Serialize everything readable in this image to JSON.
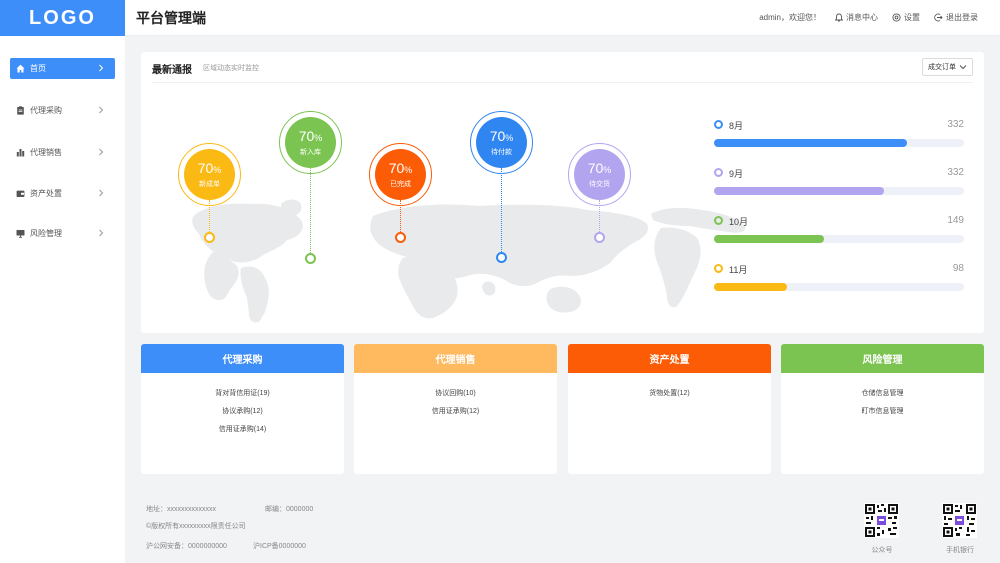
{
  "header": {
    "logo": "LOGO",
    "app_title": "平台管理端",
    "greeting": "admin，欢迎您！",
    "messages_label": "消息中心",
    "settings_label": "设置",
    "logout_label": "退出登录"
  },
  "sidebar": {
    "items": [
      {
        "label": "首页",
        "icon": "home-icon",
        "active": true
      },
      {
        "label": "代理采购",
        "icon": "clipboard-icon",
        "active": false
      },
      {
        "label": "代理销售",
        "icon": "bar-chart-icon",
        "active": false
      },
      {
        "label": "资产处置",
        "icon": "wallet-icon",
        "active": false
      },
      {
        "label": "风险管理",
        "icon": "monitor-icon",
        "active": false
      }
    ]
  },
  "panel": {
    "title": "最新通报",
    "subtitle": "区域动态实时监控",
    "select_value": "成交订单",
    "bubbles": [
      {
        "pct": "70",
        "unit": "%",
        "label": "新成单",
        "color": "#fbb913"
      },
      {
        "pct": "70",
        "unit": "%",
        "label": "新入库",
        "color": "#7cc452"
      },
      {
        "pct": "70",
        "unit": "%",
        "label": "已完成",
        "color": "#fb5c05"
      },
      {
        "pct": "70",
        "unit": "%",
        "label": "待付款",
        "color": "#2f86f0"
      },
      {
        "pct": "70",
        "unit": "%",
        "label": "待交货",
        "color": "#b3a4ef"
      }
    ],
    "bars": [
      {
        "label": "8月",
        "value": "332",
        "fraction": 0.77,
        "color": "#3d8ef8"
      },
      {
        "label": "9月",
        "value": "332",
        "fraction": 0.68,
        "color": "#b3a4ef"
      },
      {
        "label": "10月",
        "value": "149",
        "fraction": 0.44,
        "color": "#7cc452"
      },
      {
        "label": "11月",
        "value": "98",
        "fraction": 0.29,
        "color": "#fbb913"
      }
    ]
  },
  "cards": [
    {
      "title": "代理采购",
      "color": "#3d8ef8",
      "items": [
        "背对背信用证(19)",
        "协议承购(12)",
        "信用证承购(14)"
      ]
    },
    {
      "title": "代理销售",
      "color": "#ffb95e",
      "items": [
        "协议回购(10)",
        "信用证承购(12)"
      ]
    },
    {
      "title": "资产处置",
      "color": "#fb5c05",
      "items": [
        "货物处置(12)"
      ]
    },
    {
      "title": "风险管理",
      "color": "#7cc452",
      "items": [
        "仓储信息管理",
        "盯市信息管理"
      ]
    }
  ],
  "footer": {
    "address": "地址：xxxxxxxxxxxxxx",
    "postcode": "邮编：0000000",
    "copyright": "©版权所有xxxxxxxxx限责任公司",
    "police": "沪公网安备：0000000000",
    "icp": "沪ICP备0000000",
    "qr1_label": "公众号",
    "qr2_label": "手机银行"
  }
}
